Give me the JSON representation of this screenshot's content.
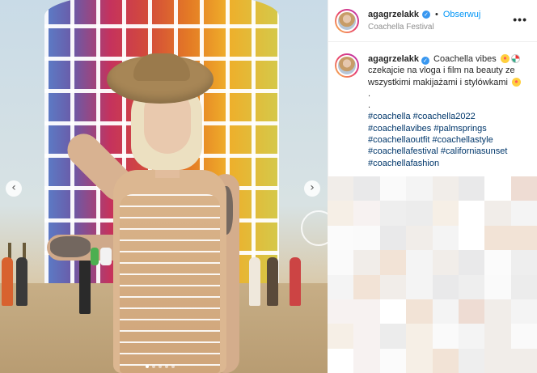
{
  "post": {
    "author": {
      "username": "agagrzelakk",
      "verified": true,
      "location": "Coachella Festival"
    },
    "follow_label": "Obserwuj",
    "separator": "•",
    "more_label": "•••",
    "caption": {
      "username": "agagrzelakk",
      "text_line1": "Coachella vibes",
      "text_line2": "czekajcie na vloga i film na beauty ze",
      "text_line3": "wszystkimi makijażami i stylówkami",
      "dot1": ".",
      "dot2": ".",
      "hashtags_rows": [
        [
          "#coachella",
          "#coachella2022"
        ],
        [
          "#coachellavibes",
          "#palmsprings"
        ],
        [
          "#coachellaoutfit",
          "#coachellastyle"
        ],
        [
          "#coachellafestival",
          "#californiasunset"
        ],
        [
          "#coachellafashion"
        ]
      ]
    },
    "carousel": {
      "prev_icon": "‹",
      "next_icon": "›",
      "slide_count": 5,
      "active_slide": 1
    }
  },
  "colors": {
    "link": "#00376b",
    "follow": "#0095f6",
    "verified": "#3897f0",
    "text": "#262626",
    "muted": "#8e8e8e"
  }
}
